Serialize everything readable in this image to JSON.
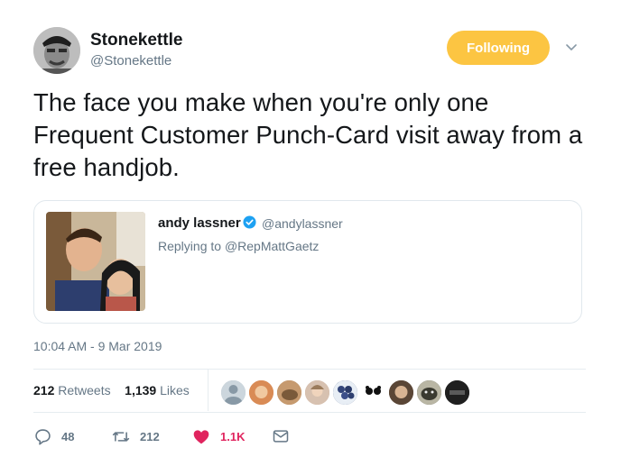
{
  "author": {
    "name": "Stonekettle",
    "handle": "@Stonekettle",
    "follow_label": "Following"
  },
  "tweet": {
    "text": "The face you make when you're only one Frequent Customer Punch-Card visit away from a free handjob.",
    "timestamp": "10:04 AM - 9 Mar 2019"
  },
  "quoted": {
    "name": "andy lassner",
    "handle": "@andylassner",
    "replying_prefix": "Replying to",
    "replying_to": "@RepMattGaetz"
  },
  "stats": {
    "retweets_count": "212",
    "retweets_label": "Retweets",
    "likes_count": "1,139",
    "likes_label": "Likes"
  },
  "actions": {
    "reply_count": "48",
    "retweet_count": "212",
    "like_count": "1.1K"
  },
  "colors": {
    "follow_button": "#fcc542",
    "verified": "#1da1f2",
    "like": "#e0245e",
    "secondary_text": "#657786"
  },
  "icons": [
    "chevron-down-icon",
    "verified-badge-icon",
    "reply-icon",
    "retweet-icon",
    "heart-icon",
    "envelope-icon"
  ]
}
